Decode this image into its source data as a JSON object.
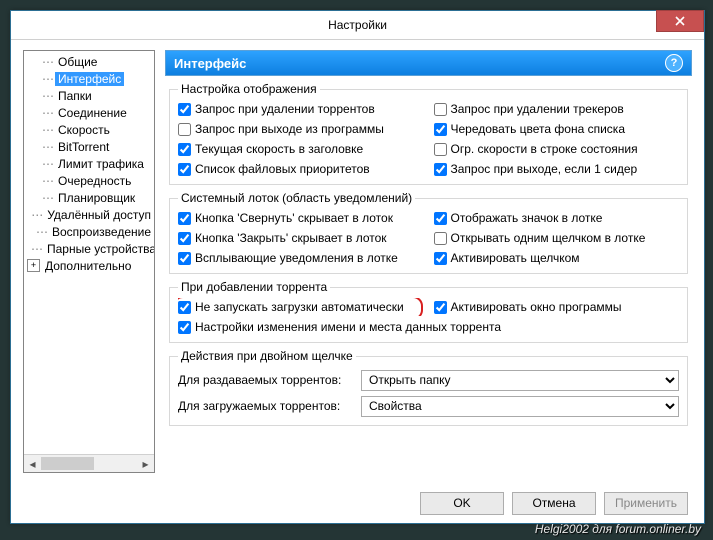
{
  "window": {
    "title": "Настройки",
    "close_tooltip": "Закрыть"
  },
  "sidebar": {
    "items": [
      {
        "label": "Общие",
        "selected": false
      },
      {
        "label": "Интерфейс",
        "selected": true
      },
      {
        "label": "Папки",
        "selected": false
      },
      {
        "label": "Соединение",
        "selected": false
      },
      {
        "label": "Скорость",
        "selected": false
      },
      {
        "label": "BitTorrent",
        "selected": false
      },
      {
        "label": "Лимит трафика",
        "selected": false
      },
      {
        "label": "Очередность",
        "selected": false
      },
      {
        "label": "Планировщик",
        "selected": false
      },
      {
        "label": "Удалённый доступ",
        "selected": false
      },
      {
        "label": "Воспроизведение",
        "selected": false
      },
      {
        "label": "Парные устройства",
        "selected": false
      },
      {
        "label": "Дополнительно",
        "selected": false,
        "expandable": true
      }
    ]
  },
  "header": {
    "title": "Интерфейс",
    "help": "?"
  },
  "groups": {
    "display": {
      "legend": "Настройка отображения",
      "items": [
        {
          "label": "Запрос при удалении торрентов",
          "checked": true
        },
        {
          "label": "Запрос при удалении трекеров",
          "checked": false
        },
        {
          "label": "Запрос при выходе из программы",
          "checked": false
        },
        {
          "label": "Чередовать цвета фона списка",
          "checked": true
        },
        {
          "label": "Текущая скорость в заголовке",
          "checked": true
        },
        {
          "label": "Огр. скорости в строке состояния",
          "checked": false
        },
        {
          "label": "Список файловых приоритетов",
          "checked": true
        },
        {
          "label": "Запрос при выходе, если 1 сидер",
          "checked": true
        }
      ]
    },
    "tray": {
      "legend": "Системный лоток (область уведомлений)",
      "items": [
        {
          "label": "Кнопка 'Свернуть' скрывает в лоток",
          "checked": true
        },
        {
          "label": "Отображать значок в лотке",
          "checked": true
        },
        {
          "label": "Кнопка 'Закрыть' скрывает в лоток",
          "checked": true
        },
        {
          "label": "Открывать одним щелчком в лотке",
          "checked": false
        },
        {
          "label": "Всплывающие уведомления в лотке",
          "checked": true
        },
        {
          "label": "Активировать щелчком",
          "checked": true
        }
      ]
    },
    "add": {
      "legend": "При добавлении торрента",
      "items": [
        {
          "label": "Не запускать загрузки автоматически",
          "checked": true,
          "highlight": true
        },
        {
          "label": "Активировать окно программы",
          "checked": true
        },
        {
          "label": "Настройки изменения имени и места данных торрента",
          "checked": true,
          "span2": true
        }
      ]
    },
    "dblclick": {
      "legend": "Действия при двойном щелчке",
      "rows": [
        {
          "label": "Для раздаваемых торрентов:",
          "value": "Открыть папку"
        },
        {
          "label": "Для загружаемых торрентов:",
          "value": "Свойства"
        }
      ]
    }
  },
  "buttons": {
    "ok": "OK",
    "cancel": "Отмена",
    "apply": "Применить"
  },
  "watermark": "Helgi2002 для forum.onliner.by"
}
